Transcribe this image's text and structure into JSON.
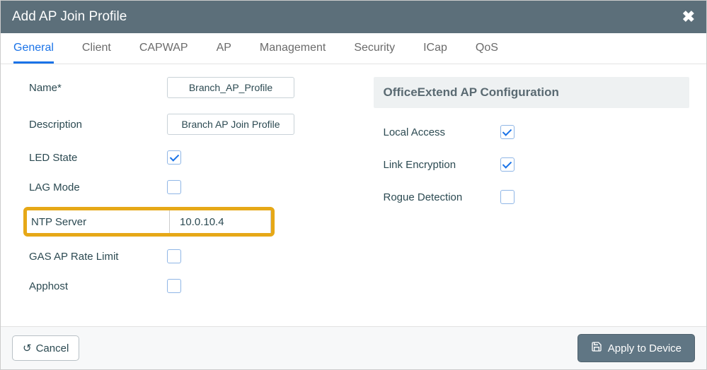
{
  "title": "Add AP Join Profile",
  "tabs": [
    "General",
    "Client",
    "CAPWAP",
    "AP",
    "Management",
    "Security",
    "ICap",
    "QoS"
  ],
  "active_tab": 0,
  "left": {
    "name_label": "Name*",
    "name_value": "Branch_AP_Profile",
    "description_label": "Description",
    "description_value": "Branch AP Join Profile",
    "led_state_label": "LED State",
    "led_state_checked": true,
    "lag_mode_label": "LAG Mode",
    "lag_mode_checked": false,
    "ntp_label": "NTP Server",
    "ntp_value": "10.0.10.4",
    "gas_label": "GAS AP Rate Limit",
    "gas_checked": false,
    "apphost_label": "Apphost",
    "apphost_checked": false
  },
  "right": {
    "section": "OfficeExtend AP Configuration",
    "local_access_label": "Local Access",
    "local_access_checked": true,
    "link_encryption_label": "Link Encryption",
    "link_encryption_checked": true,
    "rogue_detection_label": "Rogue Detection",
    "rogue_detection_checked": false
  },
  "footer": {
    "cancel": "Cancel",
    "apply": "Apply to Device"
  }
}
